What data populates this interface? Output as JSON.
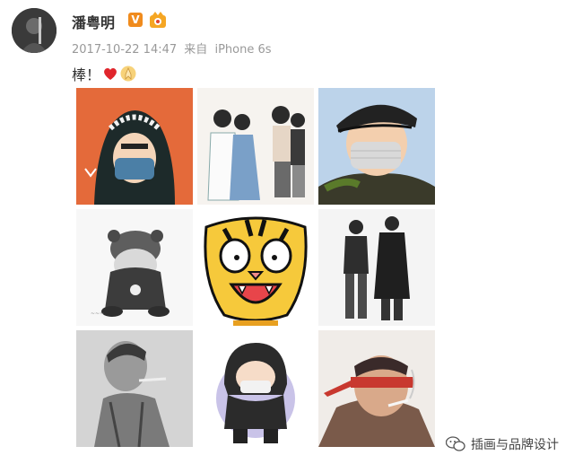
{
  "post": {
    "username": "潘粤明",
    "verified_badge": "V",
    "timestamp": "2017-10-22 14:47",
    "source_prefix": "来自",
    "source_device": "iPhone 6s",
    "text": "棒！",
    "emojis": [
      "heart-emoji",
      "praying-hands-emoji"
    ]
  },
  "images": [
    {
      "name": "illustration-masked-hoodie"
    },
    {
      "name": "illustration-couple-and-friends"
    },
    {
      "name": "illustration-cap-mask-portrait"
    },
    {
      "name": "illustration-chibi-back"
    },
    {
      "name": "illustration-tiger-face"
    },
    {
      "name": "illustration-fashion-duo"
    },
    {
      "name": "illustration-pencil-sketch"
    },
    {
      "name": "illustration-chibi-hooded"
    },
    {
      "name": "illustration-blindfold-smoker"
    }
  ],
  "watermark": {
    "text": "插画与品牌设计"
  },
  "colors": {
    "accent": "#f08b1d",
    "meta_gray": "#999999"
  }
}
